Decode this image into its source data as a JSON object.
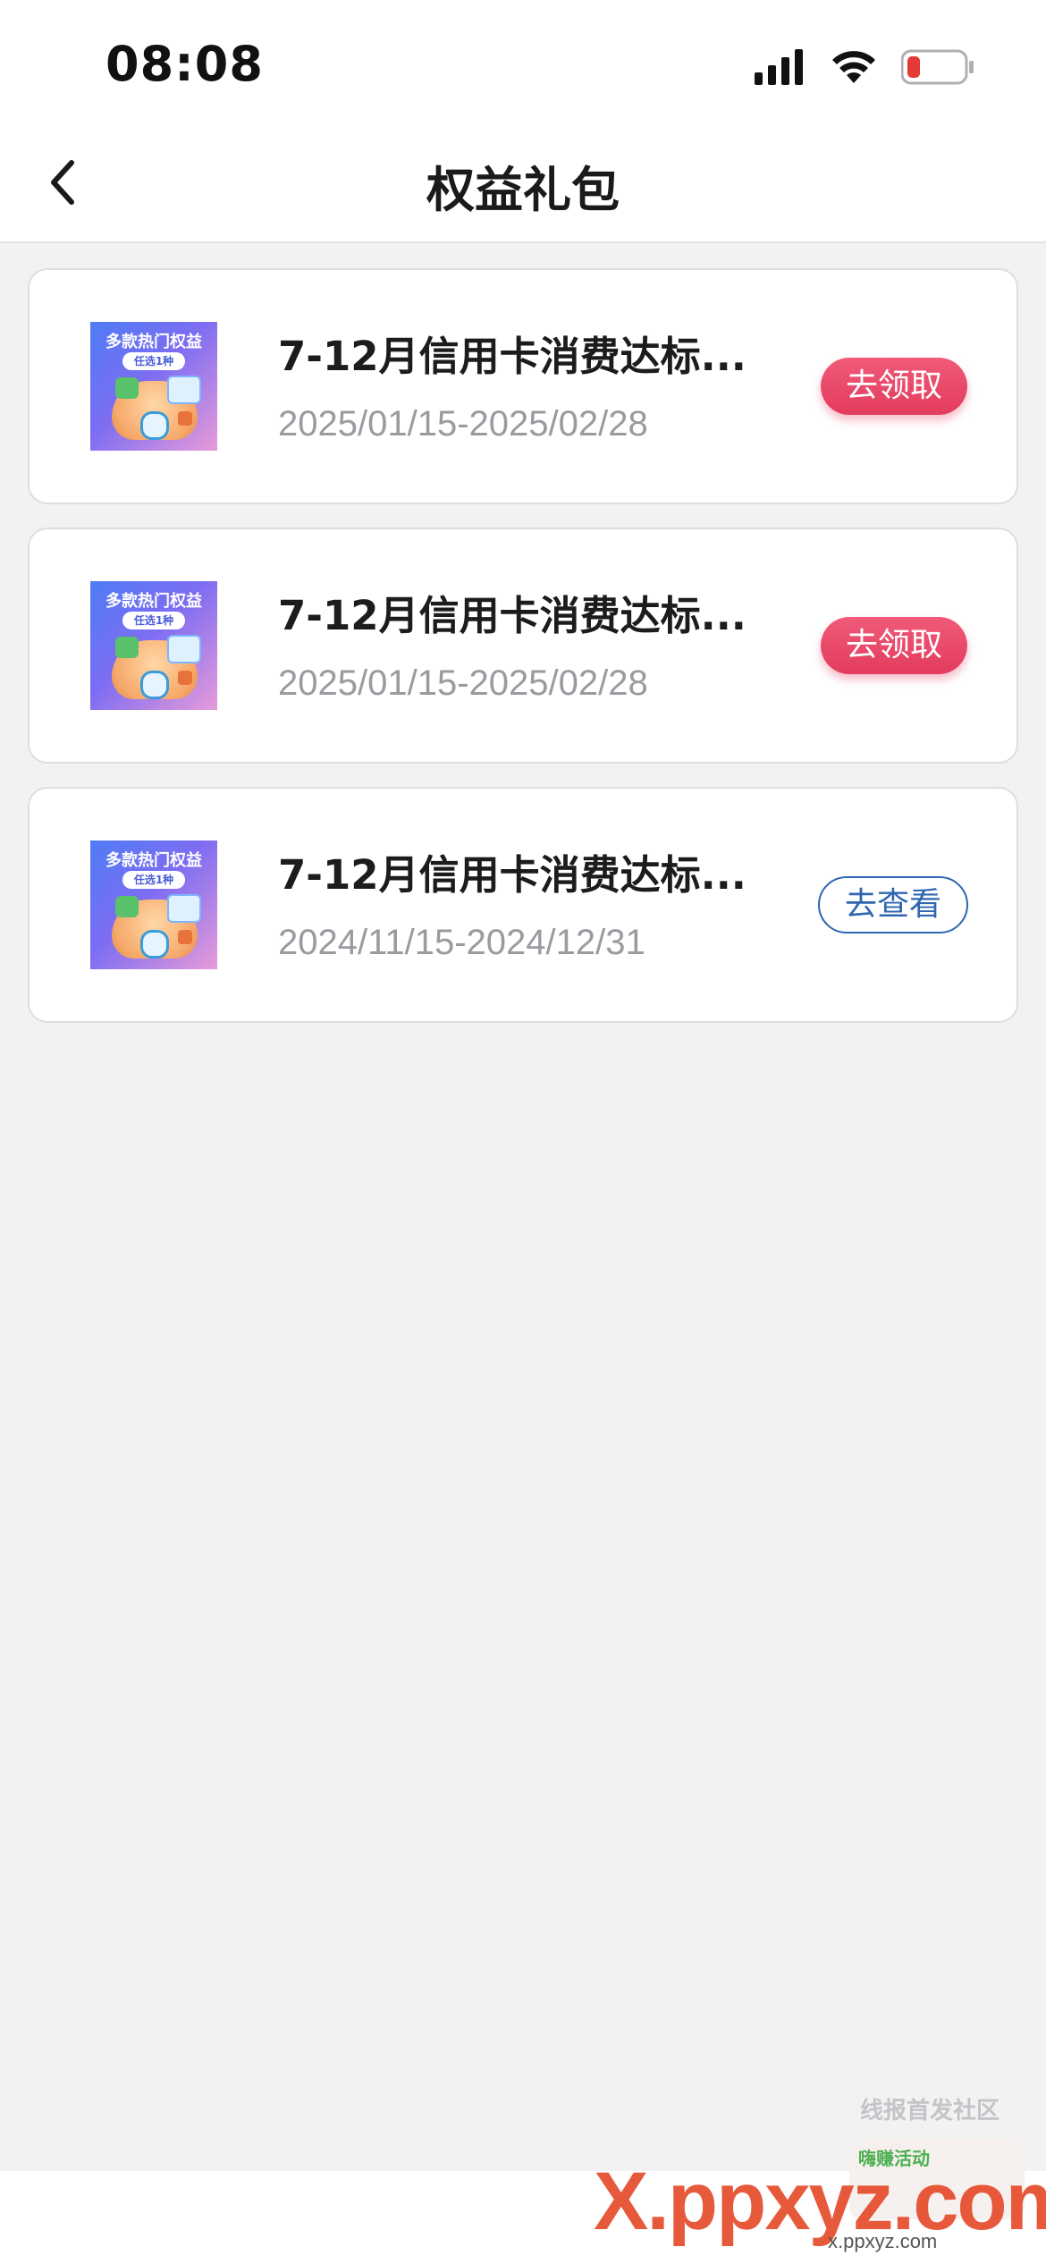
{
  "status_bar": {
    "time": "08:08",
    "icons": [
      "signal-icon",
      "wifi-icon",
      "battery-low-icon"
    ],
    "battery_color": "#e53935"
  },
  "nav": {
    "title": "权益礼包",
    "back_icon": "chevron-left-icon"
  },
  "cards": [
    {
      "thumb_title": "多款热门权益",
      "thumb_sub": "任选1种",
      "title": "7-12月信用卡消费达标...",
      "date_range": "2025/01/15-2025/02/28",
      "action": "去领取",
      "action_style": "claim"
    },
    {
      "thumb_title": "多款热门权益",
      "thumb_sub": "任选1种",
      "title": "7-12月信用卡消费达标...",
      "date_range": "2025/01/15-2025/02/28",
      "action": "去领取",
      "action_style": "claim"
    },
    {
      "thumb_title": "多款热门权益",
      "thumb_sub": "任选1种",
      "title": "7-12月信用卡消费达标...",
      "date_range": "2024/11/15-2024/12/31",
      "action": "去查看",
      "action_style": "view"
    }
  ],
  "colors": {
    "claim_button": "#e33b5e",
    "view_button": "#2f66b0",
    "background": "#f2f2f3"
  },
  "watermark": {
    "side_text": "线报首发社区",
    "badge_text": "嗨赚活动",
    "main_text": "X.ppxyz.com",
    "url_text": "x.ppxyz.com"
  }
}
